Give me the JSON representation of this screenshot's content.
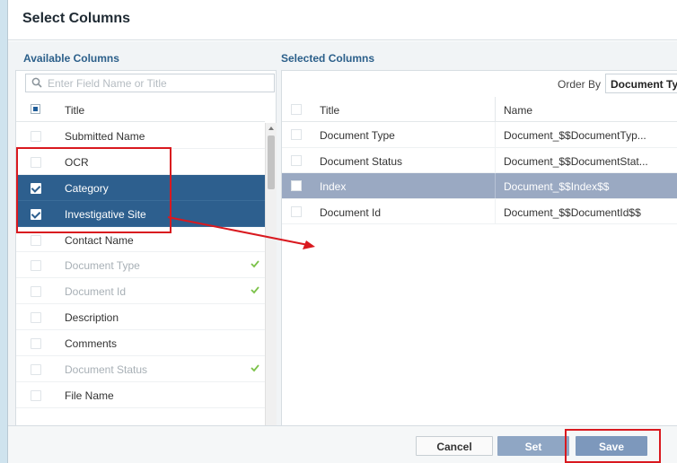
{
  "dialog": {
    "title": "Select Columns"
  },
  "available": {
    "label": "Available Columns",
    "search_placeholder": "Enter Field Name or Title",
    "header_title": "Title",
    "rows": [
      {
        "label": "Submitted Name",
        "selected": false,
        "disabled": false,
        "in_use": false
      },
      {
        "label": "OCR",
        "selected": false,
        "disabled": false,
        "in_use": false
      },
      {
        "label": "Category",
        "selected": true,
        "disabled": false,
        "in_use": false
      },
      {
        "label": "Investigative Site",
        "selected": true,
        "disabled": false,
        "in_use": false
      },
      {
        "label": "Contact Name",
        "selected": false,
        "disabled": false,
        "in_use": false
      },
      {
        "label": "Document Type",
        "selected": false,
        "disabled": true,
        "in_use": true
      },
      {
        "label": "Document Id",
        "selected": false,
        "disabled": true,
        "in_use": true
      },
      {
        "label": "Description",
        "selected": false,
        "disabled": false,
        "in_use": false
      },
      {
        "label": "Comments",
        "selected": false,
        "disabled": false,
        "in_use": false
      },
      {
        "label": "Document Status",
        "selected": false,
        "disabled": true,
        "in_use": true
      },
      {
        "label": "File Name",
        "selected": false,
        "disabled": false,
        "in_use": false
      }
    ]
  },
  "selected": {
    "label": "Selected Columns",
    "order_by_label": "Order By",
    "order_by_value": "Document Ty",
    "col_title": "Title",
    "col_name": "Name",
    "rows": [
      {
        "title": "Document Type",
        "name": "Document_$$DocumentTyp...",
        "highlight": false
      },
      {
        "title": "Document Status",
        "name": "Document_$$DocumentStat...",
        "highlight": false
      },
      {
        "title": "Index",
        "name": "Document_$$Index$$",
        "highlight": true
      },
      {
        "title": "Document Id",
        "name": "Document_$$DocumentId$$",
        "highlight": false
      }
    ]
  },
  "footer": {
    "cancel": "Cancel",
    "set": "Set",
    "save": "Save"
  },
  "colors": {
    "selected_row": "#2d5f8e",
    "highlight_row": "#9aa9c2",
    "annotation": "#d9191f",
    "in_use_check": "#7cc24a"
  }
}
